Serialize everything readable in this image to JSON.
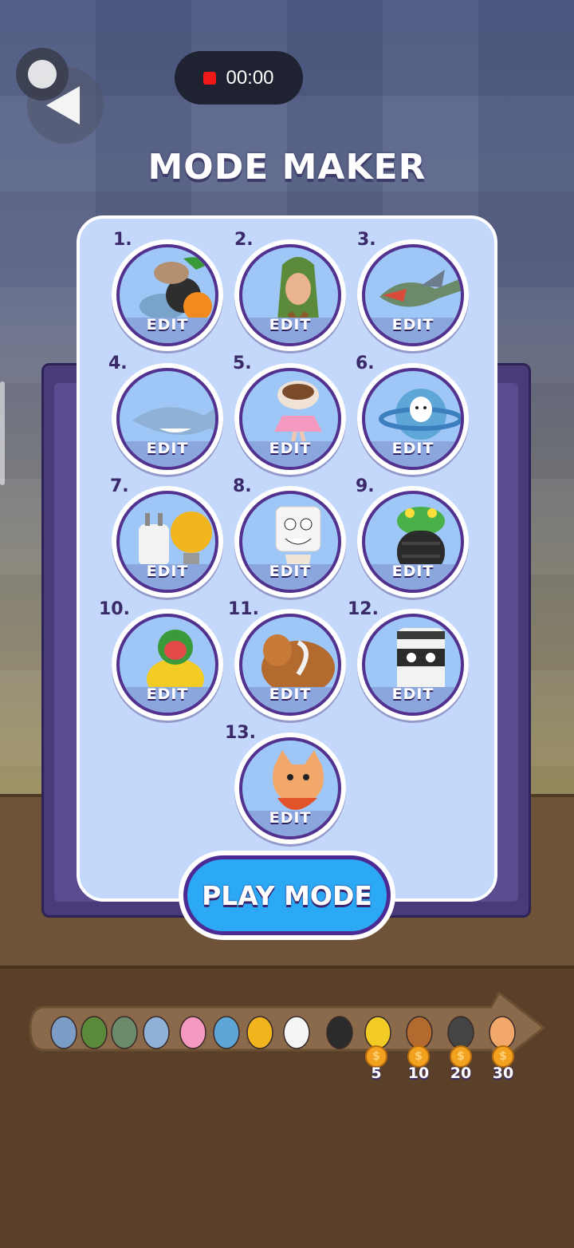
{
  "recorder": {
    "time": "00:00"
  },
  "title": "MODE MAKER",
  "slots": [
    {
      "num": "1.",
      "label": "EDIT",
      "icon": "animal-mashup-icon"
    },
    {
      "num": "2.",
      "label": "EDIT",
      "icon": "tree-man-icon"
    },
    {
      "num": "3.",
      "label": "EDIT",
      "icon": "crocodile-jet-icon"
    },
    {
      "num": "4.",
      "label": "EDIT",
      "icon": "shark-sneakers-icon"
    },
    {
      "num": "5.",
      "label": "EDIT",
      "icon": "cup-ballerina-icon"
    },
    {
      "num": "6.",
      "label": "EDIT",
      "icon": "cow-planet-icon"
    },
    {
      "num": "7.",
      "label": "EDIT",
      "icon": "plug-bulb-icon"
    },
    {
      "num": "8.",
      "label": "EDIT",
      "icon": "sugar-cube-icon"
    },
    {
      "num": "9.",
      "label": "EDIT",
      "icon": "frog-tire-icon"
    },
    {
      "num": "10.",
      "label": "EDIT",
      "icon": "monkey-banana-icon"
    },
    {
      "num": "11.",
      "label": "EDIT",
      "icon": "capybara-icon"
    },
    {
      "num": "12.",
      "label": "EDIT",
      "icon": "ninja-cup-icon"
    },
    {
      "num": "13.",
      "label": "EDIT",
      "icon": "cat-shrimp-icon"
    }
  ],
  "play_button": "PLAY MODE",
  "timeline": {
    "prices": [
      "5",
      "10",
      "20",
      "30"
    ]
  },
  "colors": {
    "accent": "#2ba9f5",
    "panel": "#c3d8fb",
    "outline": "#4b2b93"
  }
}
